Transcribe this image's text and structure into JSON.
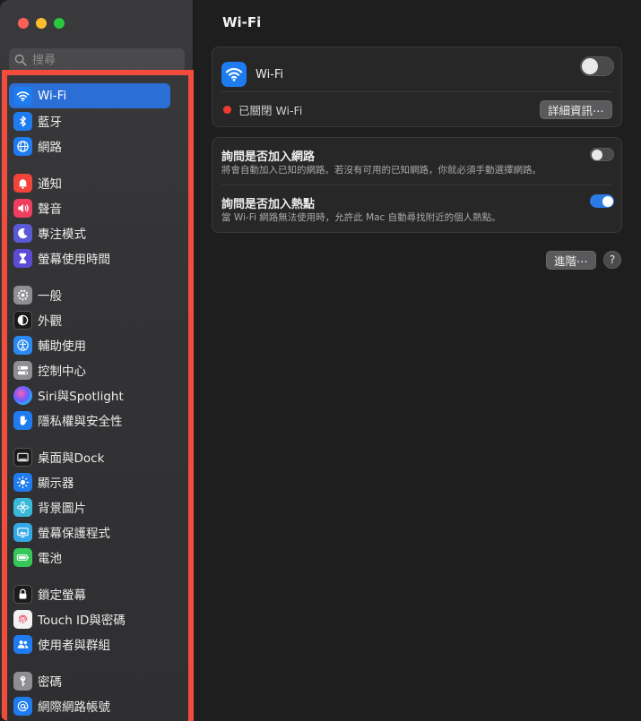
{
  "sidebar": {
    "search_placeholder": "搜尋",
    "items": [
      {
        "label": "Wi-Fi",
        "icon": "wifi-icon",
        "active": true
      },
      {
        "label": "藍牙",
        "icon": "bluetooth-icon"
      },
      {
        "label": "網路",
        "icon": "globe-icon"
      },
      {
        "label": "通知",
        "icon": "bell-icon"
      },
      {
        "label": "聲音",
        "icon": "speaker-icon"
      },
      {
        "label": "專注模式",
        "icon": "moon-icon"
      },
      {
        "label": "螢幕使用時間",
        "icon": "hourglass-icon"
      },
      {
        "label": "一般",
        "icon": "gear-icon"
      },
      {
        "label": "外觀",
        "icon": "appearance-icon"
      },
      {
        "label": "輔助使用",
        "icon": "accessibility-icon"
      },
      {
        "label": "控制中心",
        "icon": "control-center-icon"
      },
      {
        "label": "Siri與Spotlight",
        "icon": "siri-icon"
      },
      {
        "label": "隱私權與安全性",
        "icon": "hand-icon"
      },
      {
        "label": "桌面與Dock",
        "icon": "dock-icon"
      },
      {
        "label": "顯示器",
        "icon": "sun-icon"
      },
      {
        "label": "背景圖片",
        "icon": "flower-icon"
      },
      {
        "label": "螢幕保護程式",
        "icon": "screensaver-icon"
      },
      {
        "label": "電池",
        "icon": "battery-icon"
      },
      {
        "label": "鎖定螢幕",
        "icon": "lock-icon"
      },
      {
        "label": "Touch ID與密碼",
        "icon": "fingerprint-icon"
      },
      {
        "label": "使用者與群組",
        "icon": "users-icon"
      },
      {
        "label": "密碼",
        "icon": "key-icon"
      },
      {
        "label": "網際網路帳號",
        "icon": "at-icon"
      }
    ]
  },
  "main": {
    "title": "Wi-Fi",
    "wifi": {
      "label": "Wi-Fi",
      "enabled": false
    },
    "status": {
      "text": "已關閉 Wi-Fi",
      "color": "#f03a30"
    },
    "details_button": "詳細資訊⋯",
    "options": [
      {
        "title": "詢問是否加入網路",
        "desc": "將會自動加入已知的網路。若沒有可用的已知網路，你就必須手動選擇網路。",
        "enabled": false
      },
      {
        "title": "詢問是否加入熱點",
        "desc": "當 Wi-Fi 網路無法使用時，允許此 Mac 自動尋找附近的個人熱點。",
        "enabled": true
      }
    ],
    "advanced_button": "進階⋯",
    "help_button": "?"
  },
  "colors": {
    "accent": "#2a6ed6",
    "highlight_frame": "#f24c3d"
  }
}
